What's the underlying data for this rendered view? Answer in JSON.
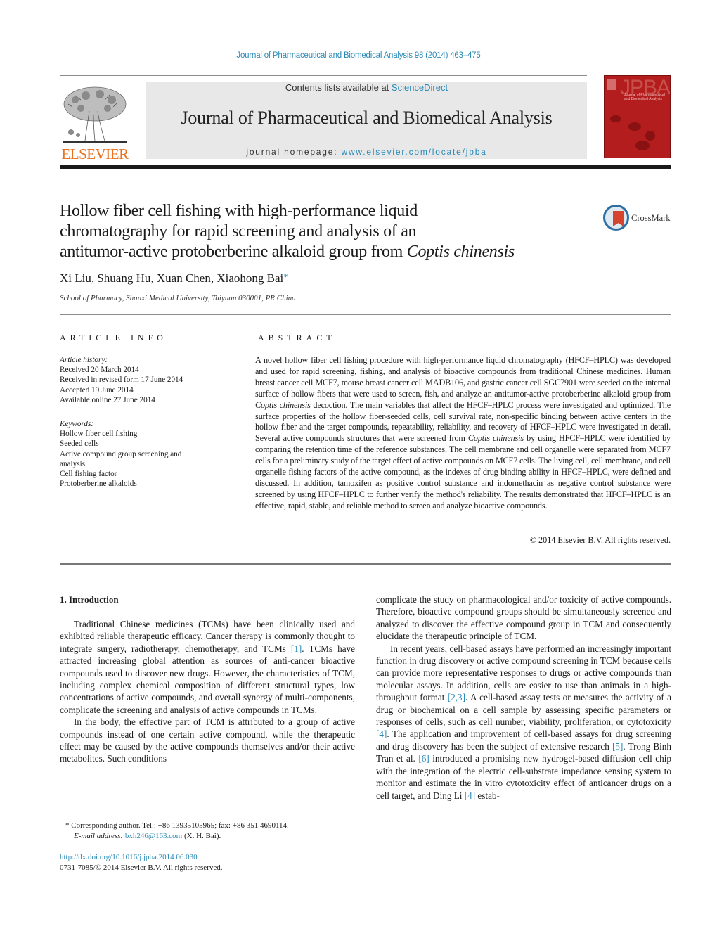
{
  "header": {
    "citation": "Journal of Pharmaceutical and Biomedical Analysis 98 (2014) 463–475",
    "contents_prefix": "Contents lists available at ",
    "contents_link": "ScienceDirect",
    "journal_title": "Journal of Pharmaceutical and Biomedical Analysis",
    "homepage_prefix": "journal homepage: ",
    "homepage_link": "www.elsevier.com/locate/jpba",
    "publisher_logo_text": "ELSEVIER",
    "cover_text": "JPBA",
    "cover_subtitle": "Journal of Pharmaceutical and Biomedical Analysis",
    "colors": {
      "link": "#2a8ab7",
      "elsevier_orange": "#e9711c",
      "cover_red": "#b41d1d"
    }
  },
  "article": {
    "title_parts": [
      "Hollow fiber cell fishing with high-performance liquid",
      "chromatography for rapid screening and analysis of an",
      "antitumor-active protoberberine alkaloid group from "
    ],
    "title_italic": "Coptis chinensis",
    "crossmark_label": "CrossMark",
    "authors": "Xi Liu, Shuang Hu, Xuan Chen, Xiaohong Bai",
    "corresponding_marker": "*",
    "affiliation": "School of Pharmacy, Shanxi Medical University, Taiyuan 030001, PR China"
  },
  "article_info": {
    "heading": "ARTICLE INFO",
    "history_label": "Article history:",
    "history": [
      "Received 20 March 2014",
      "Received in revised form 17 June 2014",
      "Accepted 19 June 2014",
      "Available online 27 June 2014"
    ],
    "keywords_label": "Keywords:",
    "keywords": [
      "Hollow fiber cell fishing",
      "Seeded cells",
      "Active compound group screening and analysis",
      "Cell fishing factor",
      "Protoberberine alkaloids"
    ]
  },
  "abstract": {
    "heading": "ABSTRACT",
    "part1": "A novel hollow fiber cell fishing procedure with high-performance liquid chromatography (HFCF–HPLC) was developed and used for rapid screening, fishing, and analysis of bioactive compounds from traditional Chinese medicines. Human breast cancer cell MCF7, mouse breast cancer cell MADB106, and gastric cancer cell SGC7901 were seeded on the internal surface of hollow fibers that were used to screen, fish, and analyze an antitumor-active protoberberine alkaloid group from ",
    "italic1": "Coptis chinensis",
    "part2": " decoction. The main variables that affect the HFCF–HPLC process were investigated and optimized. The surface properties of the hollow fiber-seeded cells, cell survival rate, non-specific binding between active centers in the hollow fiber and the target compounds, repeatability, reliability, and recovery of HFCF–HPLC were investigated in detail. Several active compounds structures that were screened from ",
    "italic2": "Coptis chinensis",
    "part3": " by using HFCF–HPLC were identified by comparing the retention time of the reference substances. The cell membrane and cell organelle were separated from MCF7 cells for a preliminary study of the target effect of active compounds on MCF7 cells. The living cell, cell membrane, and cell organelle fishing factors of the active compound, as the indexes of drug binding ability in HFCF–HPLC, were defined and discussed. In addition, tamoxifen as positive control substance and indomethacin as negative control substance were screened by using HFCF–HPLC to further verify the method's reliability. The results demonstrated that HFCF–HPLC is an effective, rapid, stable, and reliable method to screen and analyze bioactive compounds.",
    "copyright": "© 2014 Elsevier B.V. All rights reserved."
  },
  "introduction": {
    "heading": "1.  Introduction",
    "p1_a": "Traditional Chinese medicines (TCMs) have been clinically used and exhibited reliable therapeutic efficacy. Cancer therapy is commonly thought to integrate surgery, radiotherapy, chemotherapy, and TCMs ",
    "p1_ref1": "[1]",
    "p1_b": ". TCMs have attracted increasing global attention as sources of anti-cancer bioactive compounds used to discover new drugs. However, the characteristics of TCM, including complex chemical composition of different structural types, low concentrations of active compounds, and overall synergy of multi-components, complicate the screening and analysis of active compounds in TCMs.",
    "p2": "In the body, the effective part of TCM is attributed to a group of active compounds instead of one certain active compound, while the therapeutic effect may be caused by the active compounds themselves and/or their active metabolites. Such conditions",
    "p2_cont": "complicate the study on pharmacological and/or toxicity of active compounds. Therefore, bioactive compound groups should be simultaneously screened and analyzed to discover the effective compound group in TCM and consequently elucidate the therapeutic principle of TCM.",
    "p3_a": "In recent years, cell-based assays have performed an increasingly important function in drug discovery or active compound screening in TCM because cells can provide more representative responses to drugs or active compounds than molecular assays. In addition, cells are easier to use than animals in a high-throughput format ",
    "p3_ref1": "[2,3]",
    "p3_b": ". A cell-based assay tests or measures the activity of a drug or biochemical on a cell sample by assessing specific parameters or responses of cells, such as cell number, viability, proliferation, or cytotoxicity ",
    "p3_ref2": "[4]",
    "p3_c": ". The application and improvement of cell-based assays for drug screening and drug discovery has been the subject of extensive research ",
    "p3_ref3": "[5]",
    "p3_d": ". Trong Binh Tran et al. ",
    "p3_ref4": "[6]",
    "p3_e": " introduced a promising new hydrogel-based diffusion cell chip with the integration of the electric cell-substrate impedance sensing system to monitor and estimate the in vitro cytotoxicity effect of anticancer drugs on a cell target, and Ding Li ",
    "p3_ref5": "[4]",
    "p3_f": " estab-"
  },
  "footnotes": {
    "corresponding": "*  Corresponding author. Tel.: +86 13935105965; fax: +86 351 4690114.",
    "email_label": "E-mail address: ",
    "email": "bxh246@163.com",
    "email_suffix": " (X. H. Bai).",
    "doi": "http://dx.doi.org/10.1016/j.jpba.2014.06.030",
    "issn": "0731-7085/© 2014 Elsevier B.V. All rights reserved."
  }
}
